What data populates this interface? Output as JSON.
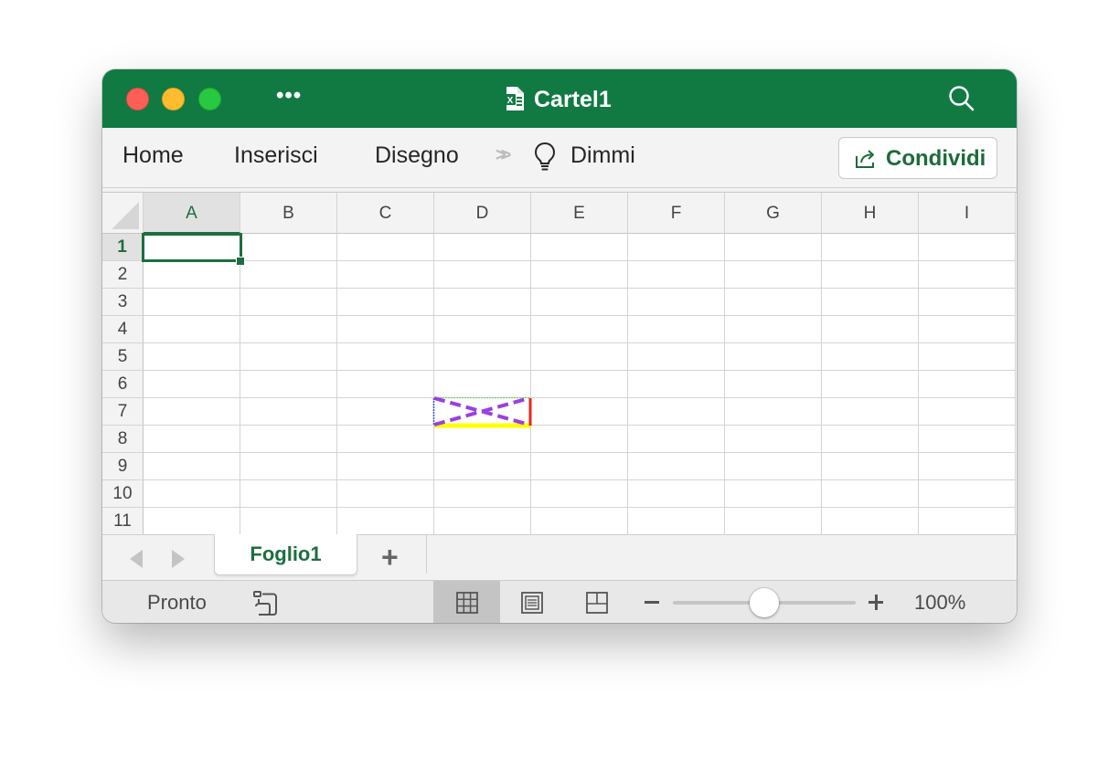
{
  "window": {
    "title": "Cartel1",
    "more_label": "•••",
    "doc_icon": "excel-document-icon",
    "search_icon": "search-icon"
  },
  "ribbon": {
    "tabs": [
      "Home",
      "Inserisci",
      "Disegno"
    ],
    "overflow_label": "»",
    "tell_me_label": "Dimmi",
    "tell_me_icon": "lightbulb-icon",
    "share_label": "Condividi",
    "share_icon": "share-icon"
  },
  "grid": {
    "columns": [
      "A",
      "B",
      "C",
      "D",
      "E",
      "F",
      "G",
      "H",
      "I"
    ],
    "rows": [
      "1",
      "2",
      "3",
      "4",
      "5",
      "6",
      "7",
      "8",
      "9",
      "10",
      "11"
    ],
    "active_cell": {
      "column": "A",
      "row": "1"
    },
    "shape": {
      "range": "D7",
      "colors": {
        "top": "#6fd06f",
        "bottom": "#ffff00",
        "left": "#2d55e8",
        "right": "#e8261c",
        "diagonals": "#9b3fe0"
      }
    }
  },
  "sheets": {
    "tabs": [
      "Foglio1"
    ],
    "active": "Foglio1",
    "add_label": "+",
    "prev_icon": "triangle-left-icon",
    "next_icon": "triangle-right-icon"
  },
  "status": {
    "text": "Pronto",
    "macro_icon": "macro-record-icon",
    "views": [
      "normal-view-icon",
      "page-layout-view-icon",
      "page-break-view-icon"
    ],
    "active_view": "normal-view-icon",
    "zoom_minus": "−",
    "zoom_plus": "+",
    "zoom_percent": 100,
    "zoom_level": "100%"
  },
  "colors": {
    "brand_green": "#117a43",
    "selection_green": "#1e6e41"
  }
}
